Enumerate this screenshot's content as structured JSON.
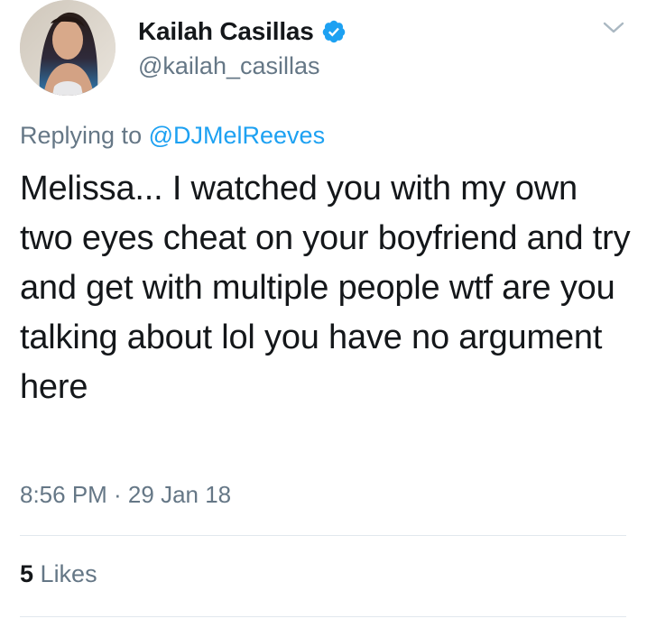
{
  "author": {
    "display_name": "Kailah Casillas",
    "handle": "@kailah_casillas",
    "verified": true,
    "avatar_icon": "profile-photo"
  },
  "reply": {
    "prefix": "Replying to",
    "mention": "@DJMelReeves"
  },
  "tweet": {
    "text": "Melissa... I watched you with my own two eyes cheat on your boyfriend and try and get with multiple people wtf are you talking about lol you have no argument here",
    "timestamp": "8:56 PM · 29 Jan 18"
  },
  "stats": {
    "likes_count": "5",
    "likes_label": "Likes"
  },
  "colors": {
    "accent": "#1da1f2",
    "text": "#14171a",
    "secondary": "#657786",
    "divider": "#e1e8ed"
  },
  "icons": {
    "verified": "verified-badge-icon",
    "menu": "chevron-down-icon"
  }
}
